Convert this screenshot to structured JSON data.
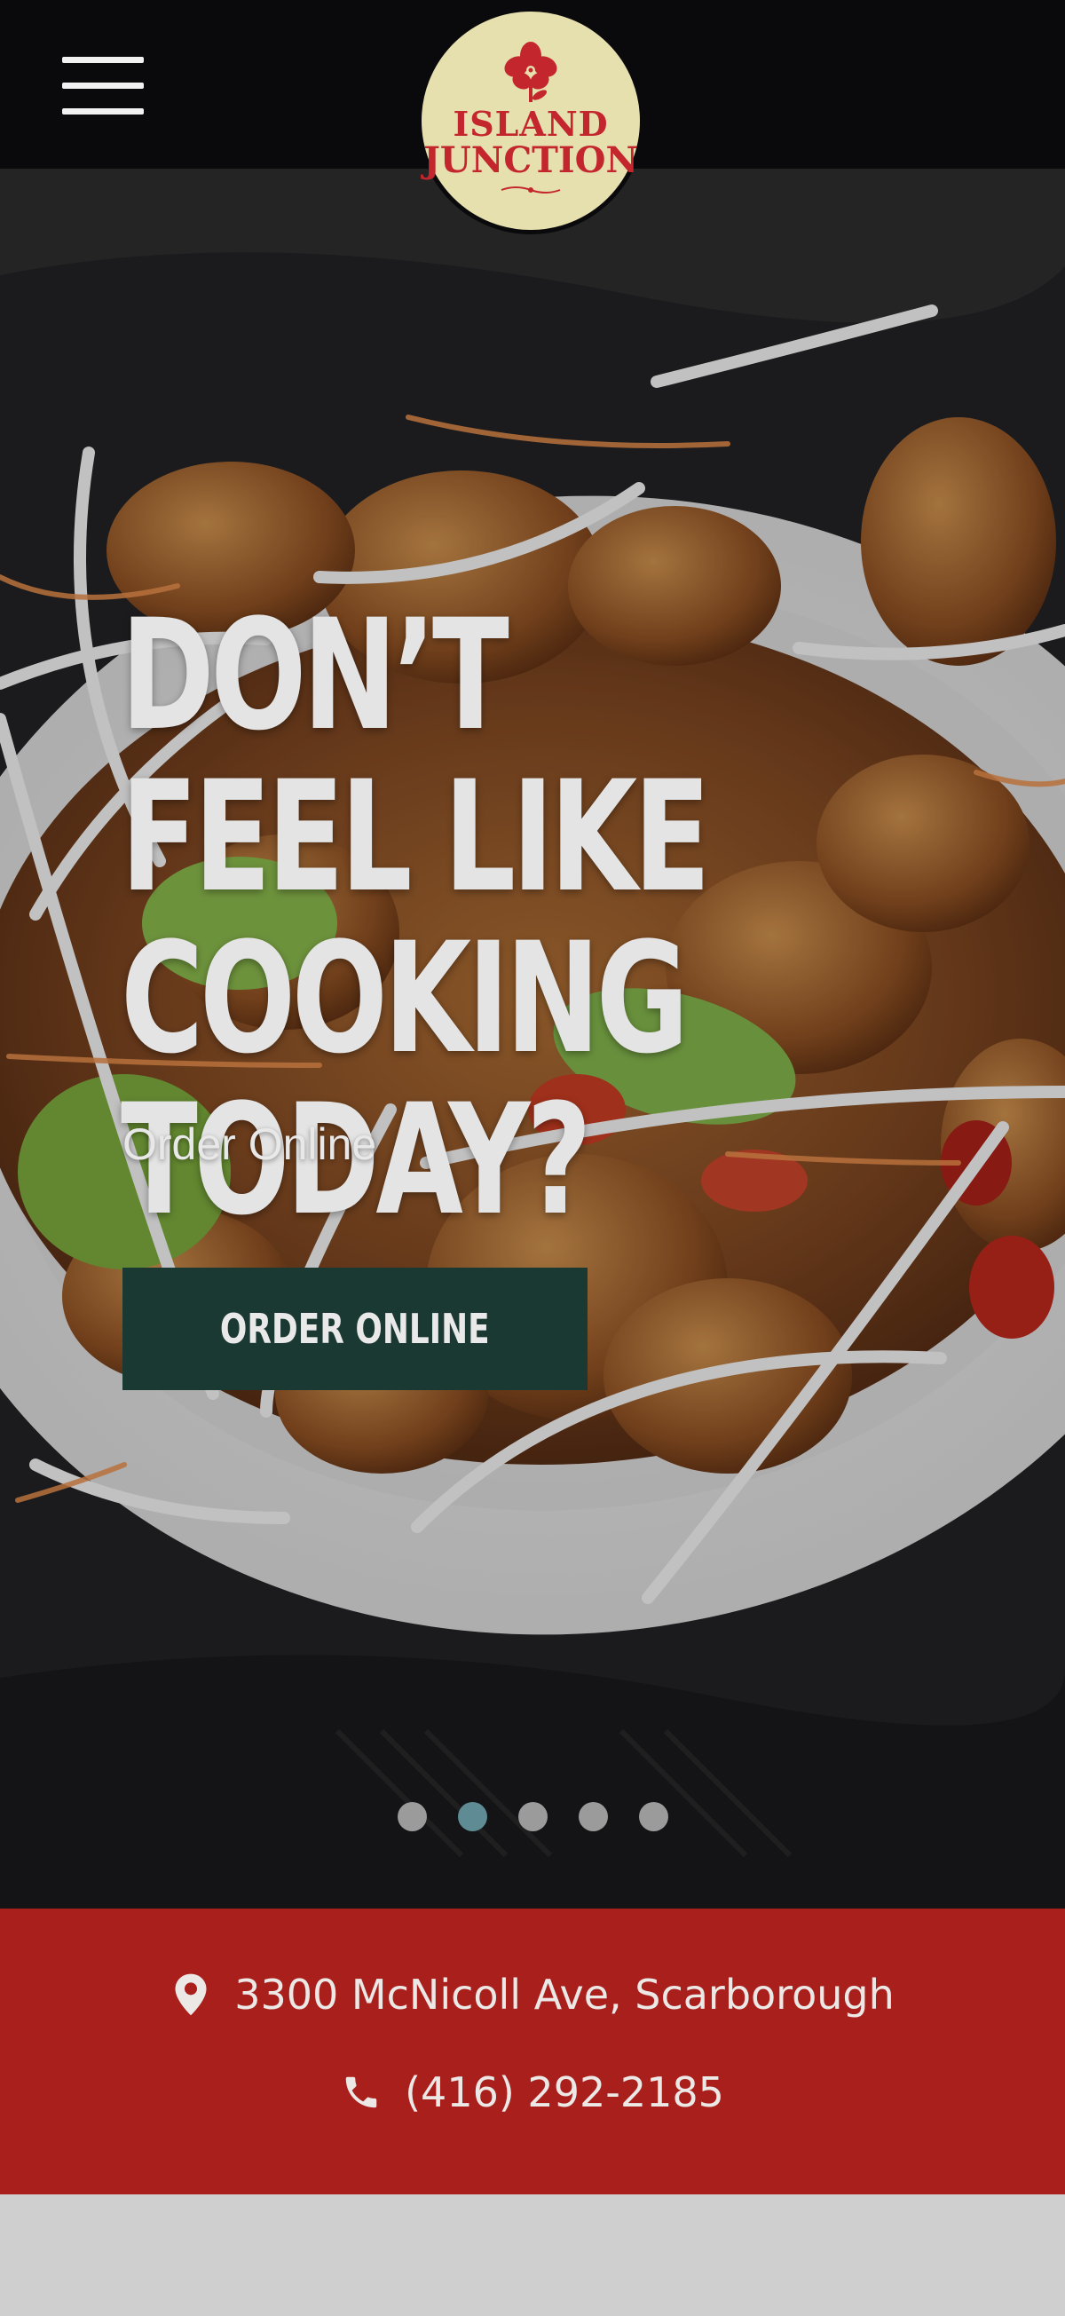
{
  "header": {
    "menu_icon": "hamburger-menu-icon",
    "logo": {
      "line1": "ISLAND",
      "line2": "JUNCTION",
      "icon": "hibiscus-flower-icon",
      "text_color": "#c4262e",
      "bg_color": "#e6dfae"
    }
  },
  "hero": {
    "headline": "DON’T FEEL LIKE COOKING TODAY?",
    "subline": "Order Online",
    "cta_label": "ORDER ONLINE",
    "cta_color": "#1a3932",
    "slides": {
      "count": 5,
      "active_index": 1
    }
  },
  "contact": {
    "bg_color": "#a91f1c",
    "address": "3300 McNicoll Ave, Scarborough",
    "address_icon": "map-pin-icon",
    "phone": "(416) 292-2185",
    "phone_icon": "phone-icon"
  }
}
